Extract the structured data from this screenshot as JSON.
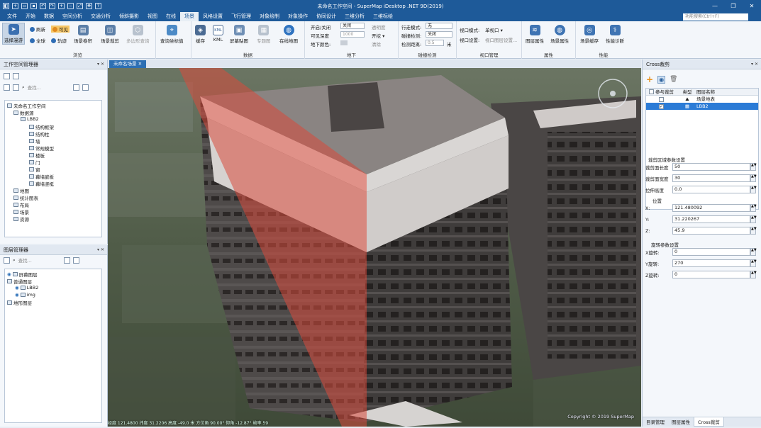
{
  "app": {
    "title": "未命名工作空间 - SuperMap iDesktop .NET 9D(2019)",
    "quick_access": [
      "save",
      "new",
      "open",
      "save-as",
      "undo",
      "redo",
      "zoom-in",
      "zoom-out",
      "full-extent",
      "pan",
      "help"
    ],
    "window_controls": [
      "—",
      "❐",
      "✕"
    ]
  },
  "menu": {
    "items": [
      "文件",
      "开始",
      "数据",
      "空间分析",
      "交通分析",
      "倾斜摄影",
      "视图",
      "在线",
      "场景",
      "风格设置",
      "飞行管理",
      "对象绘制",
      "对象操作",
      "协同设计",
      "三维分析",
      "三维标绘"
    ],
    "active": "场景",
    "search_placeholder": "功能搜索(Ctrl+F)"
  },
  "ribbon": {
    "browse": {
      "label": "浏览",
      "select": "选择漫游",
      "refresh": "刷新",
      "visible": "可见",
      "globe": "全球",
      "orbit": "轨迹",
      "scene_roll": "场景卷帘",
      "scene_clip": "场景裁剪",
      "polygon_query": "多边形查询"
    },
    "query": {
      "coord": "查询坐标值"
    },
    "data": {
      "label": "数据",
      "cache": "缓存",
      "kml": "KML",
      "screen_map": "屏幕贴图",
      "layout_map": "专题图",
      "online_map": "在线地图"
    },
    "underground": {
      "label": "地下",
      "open_close": "开启/关闭",
      "open_close_val": "关闭",
      "visible_depth": "可见深度",
      "visible_depth_val": "1000",
      "ground_color": "地下颜色:",
      "transparency": "透明度",
      "dig": "开挖 ▾",
      "clear": "清除"
    },
    "collision": {
      "label": "碰撞检测",
      "walk_mode": "行走模式:",
      "walk_mode_val": "无",
      "collide": "碰撞检测:",
      "collide_val": "关闭",
      "distance": "检测距离:",
      "distance_val": "0.5",
      "unit": "米"
    },
    "viewport": {
      "label": "视口管理",
      "mode": "视口模式:",
      "mode_val": "单视口 ▾",
      "setting": "视口设置:",
      "setting_val": "视口图层设置..."
    },
    "attrs": {
      "label": "属性",
      "layer_attr": "图层属性",
      "scene_attr": "场景属性"
    },
    "perf": {
      "label": "性能",
      "scene_cache": "场景缓存",
      "diagnose": "性能诊断"
    }
  },
  "workspace": {
    "title": "工作空间管理器",
    "search_placeholder": "查找...",
    "tree": [
      {
        "label": "未命名工作空间",
        "level": 0
      },
      {
        "label": "数据源",
        "level": 1
      },
      {
        "label": "LBB2",
        "level": 2
      },
      {
        "label": "结构框架",
        "level": 3
      },
      {
        "label": "结构柱",
        "level": 3
      },
      {
        "label": "墙",
        "level": 3
      },
      {
        "label": "常规模型",
        "level": 3
      },
      {
        "label": "楼板",
        "level": 3
      },
      {
        "label": "门",
        "level": 3
      },
      {
        "label": "窗",
        "level": 3
      },
      {
        "label": "幕墙嵌板",
        "level": 3
      },
      {
        "label": "幕墙竖梃",
        "level": 3
      },
      {
        "label": "地图",
        "level": 1
      },
      {
        "label": "统计图表",
        "level": 1
      },
      {
        "label": "布局",
        "level": 1
      },
      {
        "label": "场景",
        "level": 1
      },
      {
        "label": "资源",
        "level": 1
      }
    ]
  },
  "layers": {
    "title": "图层管理器",
    "search_placeholder": "查找...",
    "tree": [
      {
        "label": "屏幕图层",
        "level": 0
      },
      {
        "label": "普通图层",
        "level": 0
      },
      {
        "label": "LBB2",
        "level": 1
      },
      {
        "label": "img",
        "level": 1
      },
      {
        "label": "地形图层",
        "level": 0
      }
    ]
  },
  "viewport": {
    "tab": "未命名场景",
    "status": "经度 121.4800 纬度 31.2206 高度 -49.0 米  方位角 90.00° 仰角 -12.87°  帧率 59",
    "copyright": "Copyright © 2019 SuperMap"
  },
  "cross": {
    "title": "Cross裁剪",
    "columns": [
      "参与裁剪",
      "类型",
      "图层名称"
    ],
    "rows": [
      {
        "checked": false,
        "name": "场景地表",
        "selected": false
      },
      {
        "checked": true,
        "name": "LBB2",
        "selected": true
      }
    ],
    "section_clip": "裁剪区域参数设置",
    "clip_length_label": "裁剪面长度",
    "clip_length": "50",
    "clip_width_label": "裁剪面宽度",
    "clip_width": "30",
    "extrude_label": "拉伸高度",
    "extrude": "0.0",
    "section_pos": "位置",
    "x_label": "X:",
    "x": "121.480092",
    "y_label": "Y:",
    "y": "31.220267",
    "z_label": "Z:",
    "z": "45.9",
    "section_rot": "旋转参数设置",
    "rx_label": "X旋转:",
    "rx": "0",
    "ry_label": "Y旋转:",
    "ry": "270",
    "rz_label": "Z旋转:",
    "rz": "0"
  },
  "bottom_tabs": [
    "目录管理",
    "图层属性",
    "Cross裁剪"
  ],
  "bottom_active": "Cross裁剪"
}
